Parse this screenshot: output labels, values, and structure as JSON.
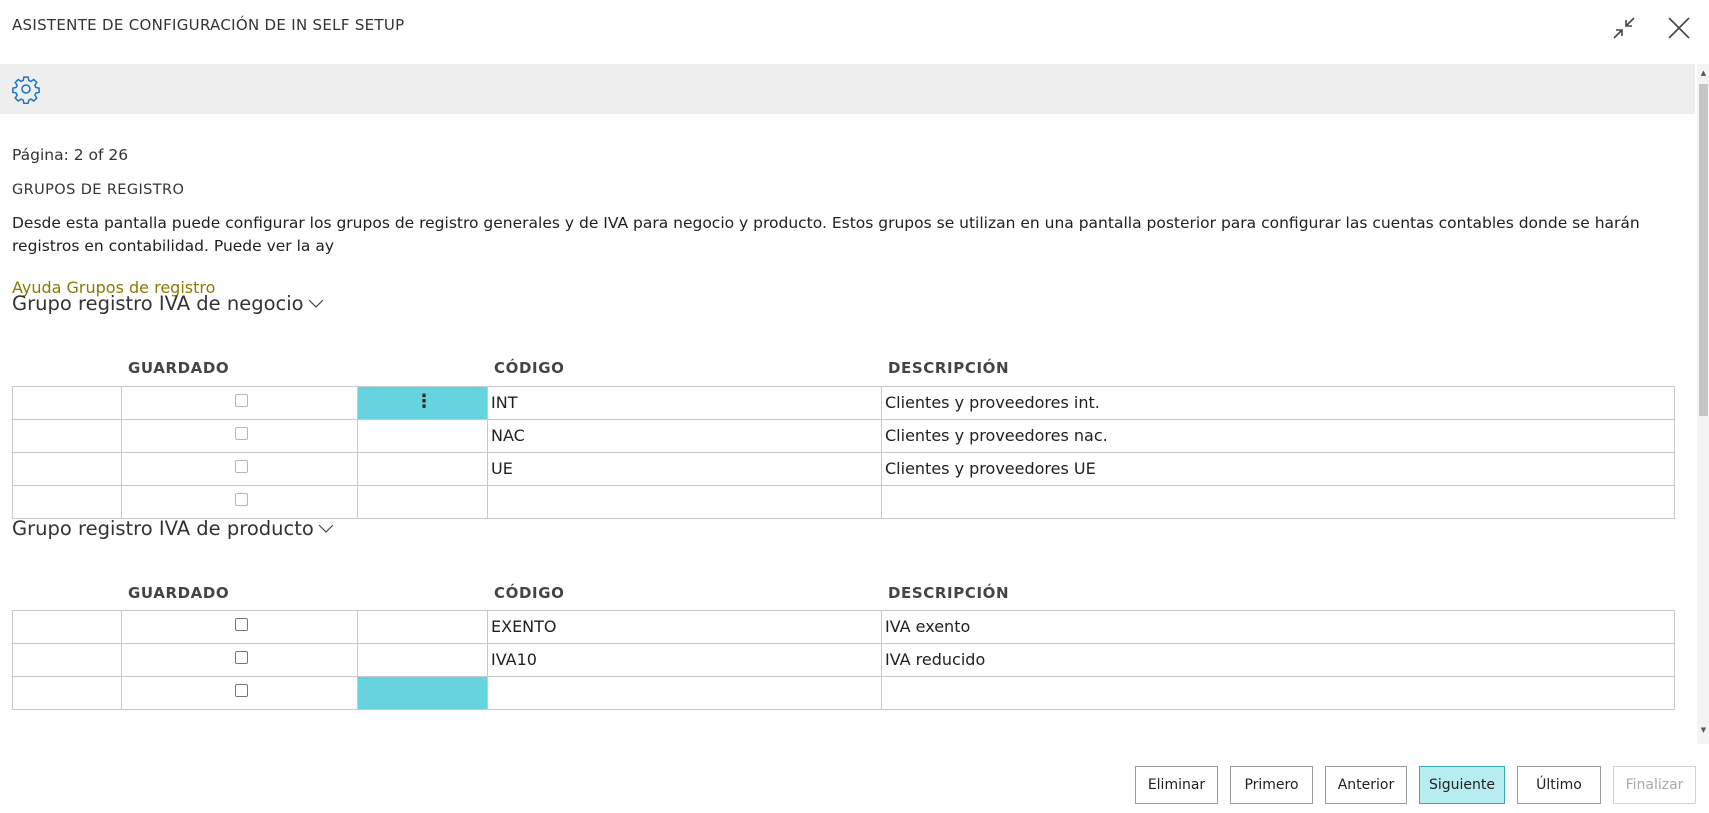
{
  "window": {
    "title": "ASISTENTE DE CONFIGURACIÓN DE IN SELF SETUP"
  },
  "page": {
    "indicator": "Página: 2 of 26",
    "section_title": "GRUPOS DE REGISTRO",
    "description": "Desde esta pantalla puede configurar los grupos de registro generales y de IVA para negocio y producto. Estos grupos se utilizan en una pantalla posterior para configurar las cuentas contables donde se harán registros en contabilidad. Puede ver la ay",
    "help_link": "Ayuda Grupos de registro"
  },
  "business_group": {
    "title": "Grupo registro IVA de negocio",
    "columns": {
      "saved": "GUARDADO",
      "code": "CÓDIGO",
      "description": "DESCRIPCIÓN"
    },
    "rows": [
      {
        "code": "INT",
        "description": "Clientes y proveedores int."
      },
      {
        "code": "NAC",
        "description": "Clientes y proveedores nac."
      },
      {
        "code": "UE",
        "description": "Clientes y proveedores UE"
      },
      {
        "code": "",
        "description": ""
      }
    ]
  },
  "product_group": {
    "title": "Grupo registro IVA de producto",
    "columns": {
      "saved": "GUARDADO",
      "code": "CÓDIGO",
      "description": "DESCRIPCIÓN"
    },
    "rows": [
      {
        "code": "EXENTO",
        "description": "IVA exento"
      },
      {
        "code": "IVA10",
        "description": "IVA reducido"
      },
      {
        "code": "",
        "description": ""
      }
    ]
  },
  "footer": {
    "delete": "Eliminar",
    "first": "Primero",
    "previous": "Anterior",
    "next": "Siguiente",
    "last": "Último",
    "finish": "Finalizar"
  },
  "colors": {
    "selected_cell": "#66d4de",
    "primary_button": "#b7ecf1",
    "link": "#8a7a00",
    "toolbar": "#eeeeee"
  }
}
